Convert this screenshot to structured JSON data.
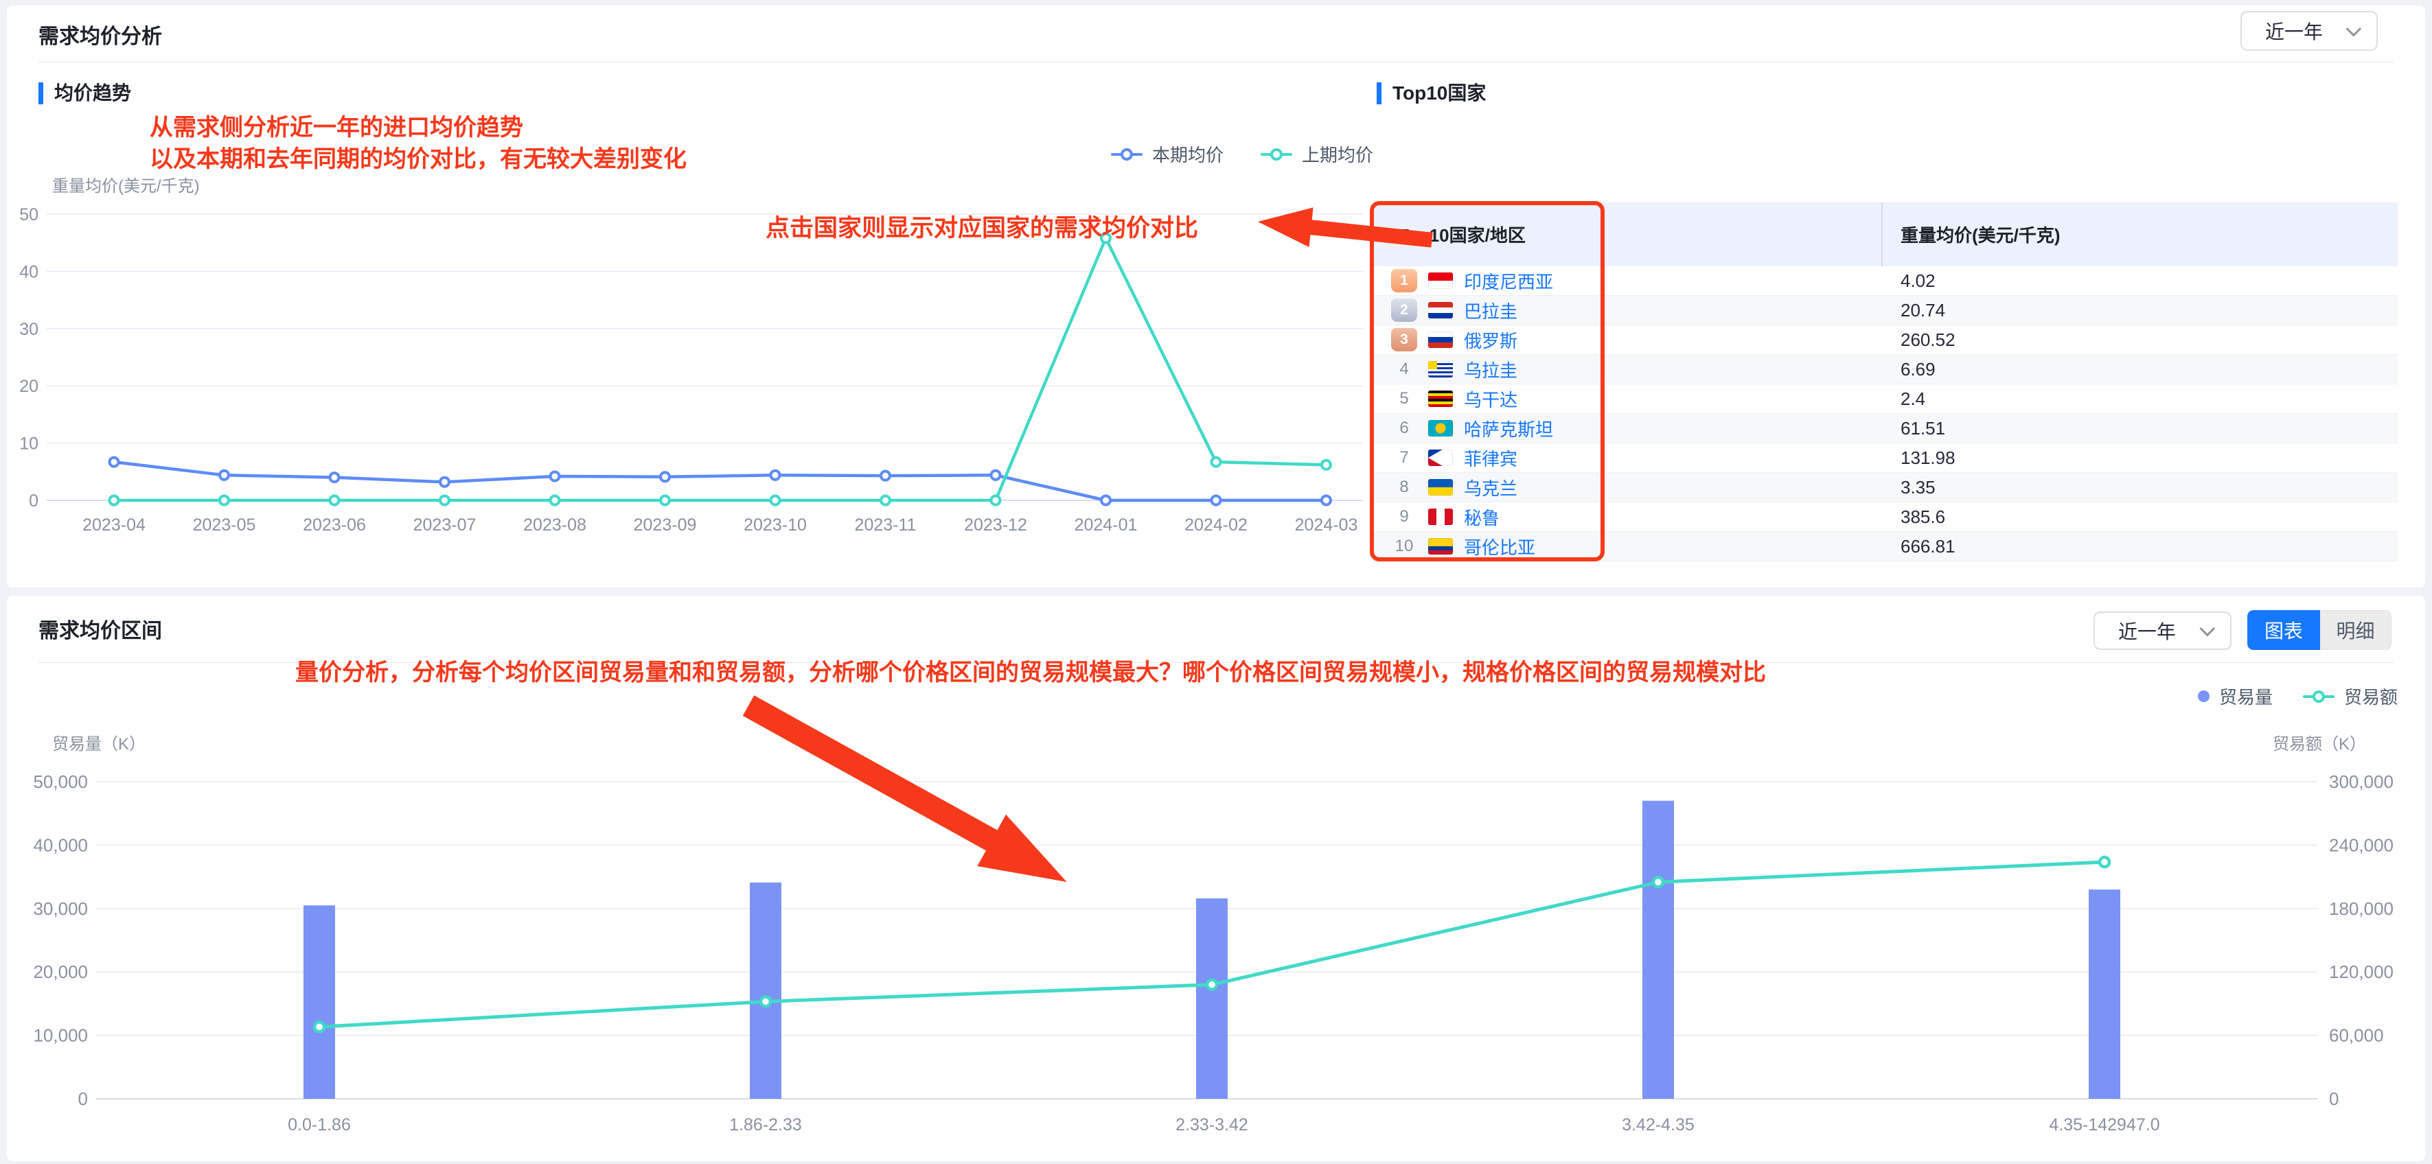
{
  "header": {
    "title": "需求均价分析",
    "range_value": "近一年"
  },
  "trend": {
    "section_title": "均价趋势",
    "annotation_line1": "从需求侧分析近一年的进口均价趋势",
    "annotation_line2": "以及本期和去年同期的均价对比，有无较大差别变化",
    "annotation_click": "点击国家则显示对应国家的需求均价对比",
    "y_axis_title": "重量均价(美元/千克)",
    "legend": [
      {
        "label": "本期均价",
        "color": "#5E8BF9"
      },
      {
        "label": "上期均价",
        "color": "#41D9C8"
      }
    ]
  },
  "top10": {
    "section_title": "Top10国家",
    "columns": [
      "Top10国家/地区",
      "重量均价(美元/千克)"
    ],
    "rows": [
      {
        "rank": 1,
        "country": "印度尼西亚",
        "flag": "indonesia",
        "value": "4.02"
      },
      {
        "rank": 2,
        "country": "巴拉圭",
        "flag": "paraguay",
        "value": "20.74"
      },
      {
        "rank": 3,
        "country": "俄罗斯",
        "flag": "russia",
        "value": "260.52"
      },
      {
        "rank": 4,
        "country": "乌拉圭",
        "flag": "uruguay",
        "value": "6.69"
      },
      {
        "rank": 5,
        "country": "乌干达",
        "flag": "uganda",
        "value": "2.4"
      },
      {
        "rank": 6,
        "country": "哈萨克斯坦",
        "flag": "kazakhstan",
        "value": "61.51"
      },
      {
        "rank": 7,
        "country": "菲律宾",
        "flag": "philippines",
        "value": "131.98"
      },
      {
        "rank": 8,
        "country": "乌克兰",
        "flag": "ukraine",
        "value": "3.35"
      },
      {
        "rank": 9,
        "country": "秘鲁",
        "flag": "peru",
        "value": "385.6"
      },
      {
        "rank": 10,
        "country": "哥伦比亚",
        "flag": "colombia",
        "value": "666.81"
      }
    ]
  },
  "range_section": {
    "title": "需求均价区间",
    "range_value": "近一年",
    "chart_button": "图表",
    "detail_button": "明细",
    "annotation": "量价分析，分析每个均价区间贸易量和和贸易额，分析哪个价格区间的贸易规模最大？哪个价格区间贸易规模小，规格价格区间的贸易规模对比",
    "left_axis_title": "贸易量（K）",
    "right_axis_title": "贸易额（K）",
    "legend": [
      {
        "label": "贸易量",
        "color": "#7A93F4"
      },
      {
        "label": "贸易额",
        "color": "#41D9C8"
      }
    ]
  },
  "chart_data": [
    {
      "type": "line",
      "title": "均价趋势",
      "x": [
        "2023-04",
        "2023-05",
        "2023-06",
        "2023-07",
        "2023-08",
        "2023-09",
        "2023-10",
        "2023-11",
        "2023-12",
        "2024-01",
        "2024-02",
        "2024-03"
      ],
      "series": [
        {
          "name": "本期均价",
          "color": "#5E8BF9",
          "values": [
            6.7,
            4.4,
            4.0,
            3.2,
            4.2,
            4.1,
            4.4,
            4.3,
            4.4,
            0,
            0,
            0
          ]
        },
        {
          "name": "上期均价",
          "color": "#41D9C8",
          "values": [
            0,
            0,
            0,
            0,
            0,
            0,
            0,
            0,
            0,
            45.8,
            6.7,
            6.2
          ]
        }
      ],
      "ylabel": "重量均价(美元/千克)",
      "ylim": [
        0,
        50
      ],
      "yticks": [
        0,
        10,
        20,
        30,
        40,
        50
      ],
      "grid": true,
      "legend_position": "top-right"
    },
    {
      "type": "bar+line",
      "title": "需求均价区间",
      "categories": [
        "0.0-1.86",
        "1.86-2.33",
        "2.33-3.42",
        "3.42-4.35",
        "4.35-142947.0"
      ],
      "series": [
        {
          "name": "贸易量",
          "type": "bar",
          "axis": "left",
          "color": "#7A93F4",
          "values": [
            30500,
            34100,
            31600,
            47000,
            33000
          ]
        },
        {
          "name": "贸易额",
          "type": "line",
          "axis": "right",
          "color": "#41D9C8",
          "values": [
            68000,
            92000,
            108000,
            205000,
            224000
          ]
        }
      ],
      "left_ylabel": "贸易量（K）",
      "right_ylabel": "贸易额（K）",
      "left_ylim": [
        0,
        50000
      ],
      "right_ylim": [
        0,
        300000
      ],
      "left_yticks": [
        0,
        10000,
        20000,
        30000,
        40000,
        50000
      ],
      "right_yticks": [
        0,
        60000,
        120000,
        180000,
        240000,
        300000
      ],
      "grid": true,
      "legend_position": "top-right"
    }
  ]
}
